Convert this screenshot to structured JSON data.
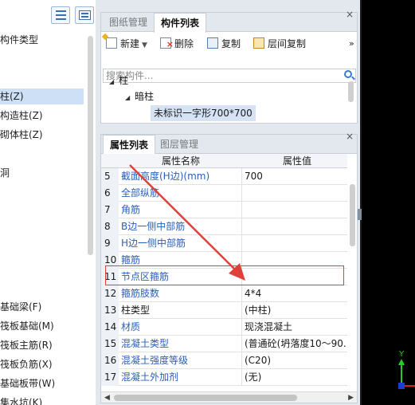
{
  "left_panel": {
    "items": [
      {
        "label": "构件类型"
      },
      {
        "label": "柱(Z)"
      },
      {
        "label": "构造柱(Z)"
      },
      {
        "label": "砌体柱(Z)"
      },
      {
        "label": "洞"
      },
      {
        "label": "基础梁(F)"
      },
      {
        "label": "筏板基础(M)"
      },
      {
        "label": "筏板主筋(R)"
      },
      {
        "label": "筏板负筋(X)"
      },
      {
        "label": "基础板带(W)"
      },
      {
        "label": "集水坑(K)"
      }
    ]
  },
  "top_panel": {
    "tabs": [
      {
        "label": "图纸管理"
      },
      {
        "label": "构件列表"
      }
    ],
    "toolbar": {
      "new_label": "新建",
      "delete_label": "删除",
      "copy_label": "复制",
      "floor_copy_label": "层间复制",
      "more_label": "»"
    },
    "search": {
      "placeholder": "搜索构件..."
    },
    "tree": {
      "root": "柱",
      "child": "暗柱",
      "leaf": "未标识一字形700*700"
    }
  },
  "bottom_panel": {
    "tabs": [
      {
        "label": "属性列表"
      },
      {
        "label": "图层管理"
      }
    ],
    "columns": {
      "name": "属性名称",
      "value": "属性值"
    },
    "rows": [
      {
        "num": "5",
        "name": "截面高度(H边)(mm)",
        "value": "700",
        "blue": true
      },
      {
        "num": "6",
        "name": "全部纵筋",
        "value": "",
        "blue": true
      },
      {
        "num": "7",
        "name": "角筋",
        "value": "",
        "blue": true
      },
      {
        "num": "8",
        "name": "B边一侧中部筋",
        "value": "",
        "blue": true
      },
      {
        "num": "9",
        "name": "H边一侧中部筋",
        "value": "",
        "blue": true
      },
      {
        "num": "10",
        "name": "箍筋",
        "value": "",
        "blue": true
      },
      {
        "num": "11",
        "name": "节点区箍筋",
        "value": "",
        "blue": true
      },
      {
        "num": "12",
        "name": "箍筋肢数",
        "value": "4*4",
        "blue": true
      },
      {
        "num": "13",
        "name": "柱类型",
        "value": "(中柱)",
        "blue": false
      },
      {
        "num": "14",
        "name": "材质",
        "value": "现浇混凝土",
        "blue": true
      },
      {
        "num": "15",
        "name": "混凝土类型",
        "value": "(普通砼(坍落度10～90...",
        "blue": true
      },
      {
        "num": "16",
        "name": "混凝土强度等级",
        "value": "(C20)",
        "blue": true
      },
      {
        "num": "17",
        "name": "混凝土外加剂",
        "value": "(无)",
        "blue": true
      }
    ]
  },
  "axis": {
    "y_label": "Y"
  },
  "colors": {
    "highlight": "#e0403a",
    "link_blue": "#2a5fb8",
    "axis_green": "#22cc22",
    "axis_red": "#d82020"
  }
}
